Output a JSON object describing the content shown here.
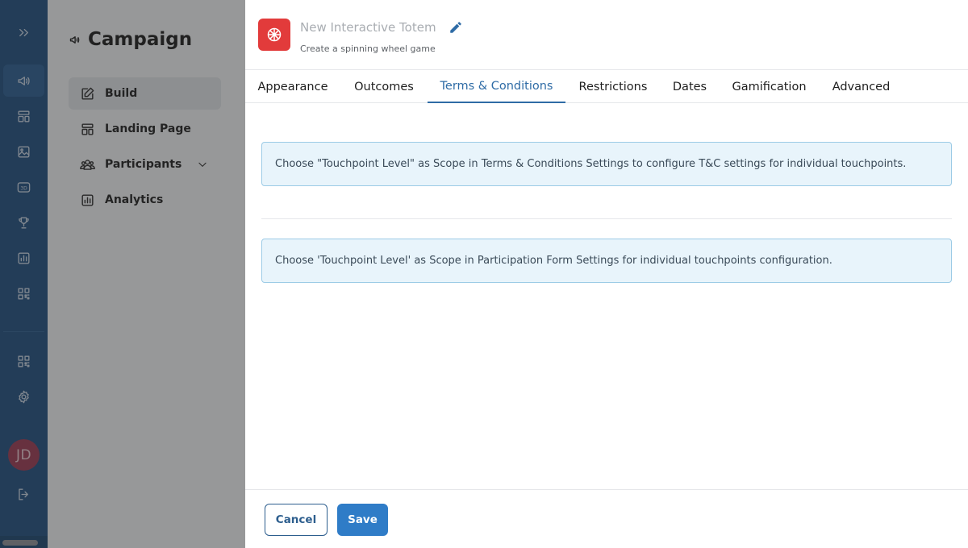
{
  "nav": {
    "title": "Campaign",
    "items": [
      {
        "label": "Build"
      },
      {
        "label": "Landing Page"
      },
      {
        "label": "Participants"
      },
      {
        "label": "Analytics"
      }
    ]
  },
  "rail": {
    "avatar_initials": "JD"
  },
  "drawer": {
    "title": "New Interactive Totem",
    "subtitle": "Create a spinning wheel game",
    "tabs": [
      {
        "label": "Appearance"
      },
      {
        "label": "Outcomes"
      },
      {
        "label": "Terms & Conditions"
      },
      {
        "label": "Restrictions"
      },
      {
        "label": "Dates"
      },
      {
        "label": "Gamification"
      },
      {
        "label": "Advanced"
      }
    ],
    "active_tab": "Terms & Conditions",
    "alerts": [
      {
        "text": "Choose \"Touchpoint Level\" as Scope in Terms & Conditions Settings to configure T&C settings for individual touchpoints."
      },
      {
        "text": "Choose 'Touchpoint Level' as Scope in Participation Form Settings for individual touchpoints configuration."
      }
    ],
    "footer": {
      "cancel_label": "Cancel",
      "save_label": "Save"
    }
  },
  "colors": {
    "rail": "#1f4f80",
    "accent": "#2f6ca6",
    "save_button": "#2f7cc7",
    "game_icon": "#e23b3b",
    "alert_bg": "#e8f4fb"
  }
}
